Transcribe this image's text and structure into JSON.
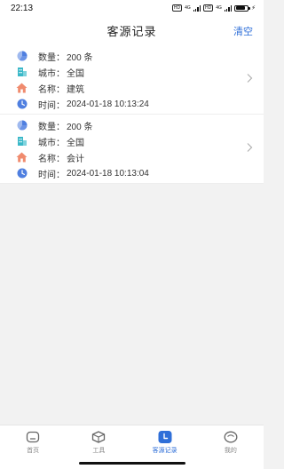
{
  "status_bar": {
    "time": "22:13",
    "hd1": "HD",
    "net1": "4G",
    "hd2": "HD",
    "net2": "4G",
    "battery_level": 0.85
  },
  "header": {
    "title": "客源记录",
    "action_label": "清空"
  },
  "colors": {
    "accent": "#2f6fd8",
    "pie_icon": "#4f7fe0",
    "building_icon": "#3ab8c8",
    "house_icon": "#f08b6e",
    "clock_icon": "#4f7fe0"
  },
  "records": [
    {
      "count_label": "数量：",
      "count_value": "200 条",
      "city_label": "城市：",
      "city_value": "全国",
      "name_label": "名称：",
      "name_value": "建筑",
      "time_label": "时间：",
      "time_value": "2024-01-18 10:13:24"
    },
    {
      "count_label": "数量：",
      "count_value": "200 条",
      "city_label": "城市：",
      "city_value": "全国",
      "name_label": "名称：",
      "name_value": "会计",
      "time_label": "时间：",
      "time_value": "2024-01-18 10:13:04"
    }
  ],
  "tabbar": {
    "items": [
      {
        "label": "首页",
        "icon": "home-icon",
        "active": false
      },
      {
        "label": "工具",
        "icon": "box-icon",
        "active": false
      },
      {
        "label": "客源记录",
        "icon": "clock-icon",
        "active": true
      },
      {
        "label": "我的",
        "icon": "face-icon",
        "active": false
      }
    ]
  }
}
